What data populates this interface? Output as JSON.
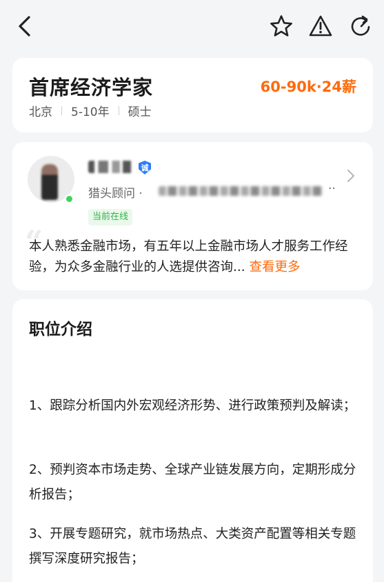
{
  "job": {
    "title": "首席经济学家",
    "salary": "60-90k·24薪",
    "location": "北京",
    "experience": "5-10年",
    "education": "硕士"
  },
  "hunter": {
    "verified_badge": "诚",
    "role": "猎头顾问 ·",
    "ellipsis": "··",
    "online_status": "当前在线",
    "intro": "本人熟悉金融市场，有五年以上金融市场人才服务工作经验，为众多金融行业的人选提供咨询...",
    "more_label": "查看更多"
  },
  "description": {
    "section_title": "职位介绍",
    "items": [
      "1、跟踪分析国内外宏观经济形势、进行政策预判及解读；",
      "2、预判资本市场走势、全球产业链发展方向，定期形成分析报告；",
      "3、开展专题研究，就市场热点、大类资产配置等相关专题撰写深度研究报告；"
    ]
  },
  "icons": [
    "back-icon",
    "star-icon",
    "warning-icon",
    "share-icon",
    "chevron-right-icon",
    "quote-icon"
  ],
  "colors": {
    "accent": "#ff6a0a",
    "online": "#3fd25d",
    "verify": "#2f7cf6"
  }
}
